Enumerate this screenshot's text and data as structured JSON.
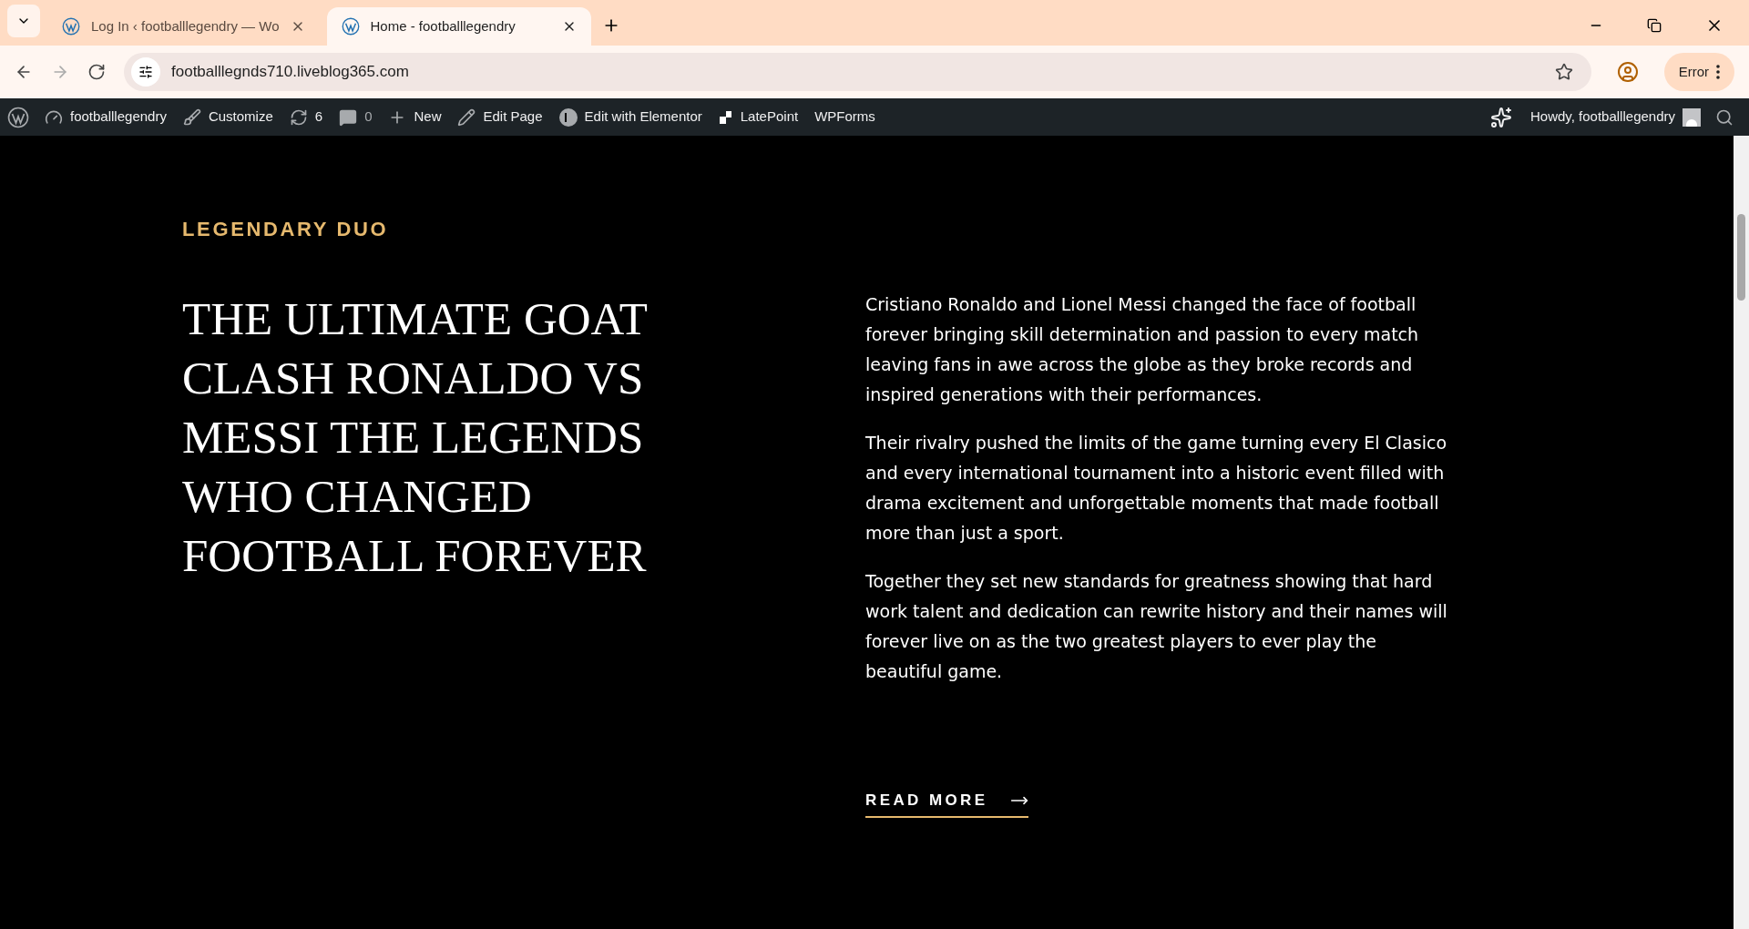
{
  "browser": {
    "tabs": [
      {
        "title": "Log In ‹ footballlegendry — Wo",
        "selected": false
      },
      {
        "title": "Home - footballlegendry",
        "selected": true
      }
    ],
    "url": "footballlegnds710.liveblog365.com",
    "profile_status": "Error"
  },
  "admin_bar": {
    "items": [
      {
        "kind": "site",
        "label": "footballlegendry"
      },
      {
        "kind": "customize",
        "label": "Customize"
      },
      {
        "kind": "updates",
        "label": "6"
      },
      {
        "kind": "comments",
        "label": "0"
      },
      {
        "kind": "new",
        "label": "New"
      },
      {
        "kind": "edit",
        "label": "Edit Page"
      },
      {
        "kind": "elementor",
        "label": "Edit with Elementor"
      },
      {
        "kind": "latepoint",
        "label": "LatePoint"
      },
      {
        "kind": "plain",
        "label": "WPForms"
      }
    ],
    "greeting": "Howdy, footballlegendry"
  },
  "content": {
    "eyebrow": "LEGENDARY DUO",
    "heading": "THE ULTIMATE GOAT CLASH RONALDO VS MESSI THE LEGENDS WHO CHANGED FOOTBALL FOREVER",
    "paragraphs": [
      "Cristiano Ronaldo and Lionel Messi changed the face of football forever bringing skill determination and passion to every match leaving fans in awe across the globe as they broke records and inspired generations with their performances.",
      "Their rivalry pushed the limits of the game turning every El Clasico and every international tournament into a historic event filled with drama excitement and unforgettable moments that made football more than just a sport.",
      "Together they set new standards for greatness showing that hard work talent and dedication can rewrite history and their names will forever live on as the two greatest players to ever play the beautiful game."
    ],
    "link": "READ MORE"
  }
}
